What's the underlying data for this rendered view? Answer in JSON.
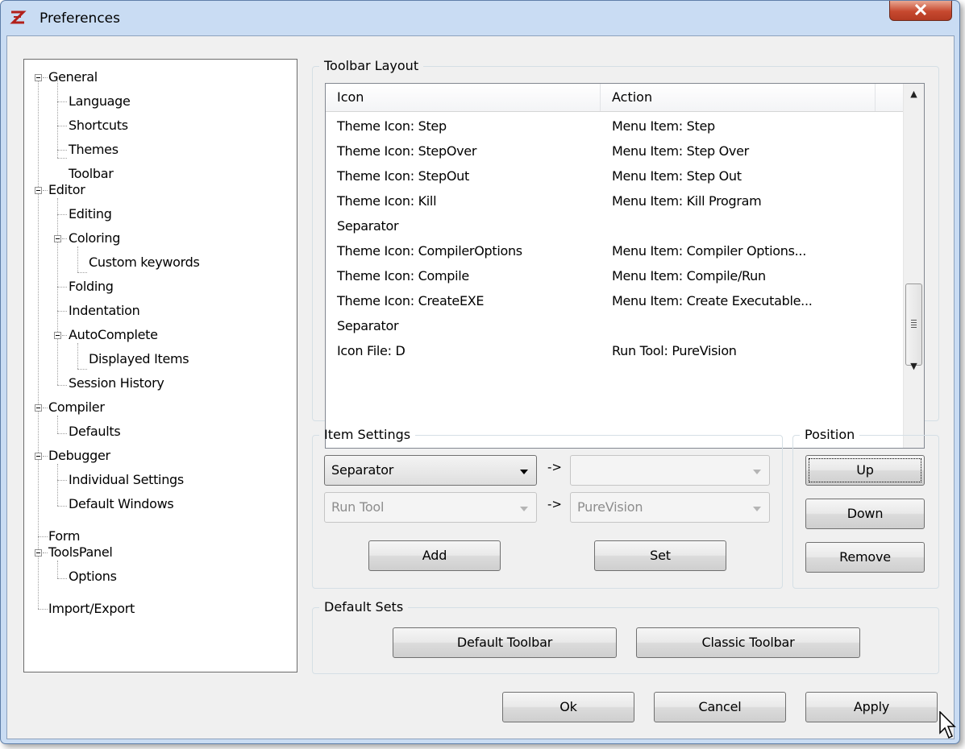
{
  "window": {
    "title": "Preferences"
  },
  "tree": {
    "items": [
      {
        "label": "General"
      },
      {
        "label": "Language"
      },
      {
        "label": "Shortcuts"
      },
      {
        "label": "Themes"
      },
      {
        "label": "Toolbar"
      },
      {
        "label": "Editor"
      },
      {
        "label": "Editing"
      },
      {
        "label": "Coloring"
      },
      {
        "label": "Custom keywords"
      },
      {
        "label": "Folding"
      },
      {
        "label": "Indentation"
      },
      {
        "label": "AutoComplete"
      },
      {
        "label": "Displayed Items"
      },
      {
        "label": "Session History"
      },
      {
        "label": "Compiler"
      },
      {
        "label": "Defaults"
      },
      {
        "label": "Debugger"
      },
      {
        "label": "Individual Settings"
      },
      {
        "label": "Default Windows"
      },
      {
        "label": "Form"
      },
      {
        "label": "ToolsPanel"
      },
      {
        "label": "Options"
      },
      {
        "label": "Import/Export"
      }
    ]
  },
  "toolbar_layout": {
    "legend": "Toolbar Layout",
    "columns": [
      "Icon",
      "Action"
    ],
    "rows": [
      {
        "icon": "Theme Icon: Step",
        "action": "Menu Item: Step"
      },
      {
        "icon": "Theme Icon: StepOver",
        "action": "Menu Item: Step Over"
      },
      {
        "icon": "Theme Icon: StepOut",
        "action": "Menu Item: Step Out"
      },
      {
        "icon": "Theme Icon: Kill",
        "action": "Menu Item: Kill Program"
      },
      {
        "icon": "Separator",
        "action": ""
      },
      {
        "icon": "Theme Icon: CompilerOptions",
        "action": "Menu Item: Compiler Options..."
      },
      {
        "icon": "Theme Icon: Compile",
        "action": "Menu Item: Compile/Run"
      },
      {
        "icon": "Theme Icon: CreateEXE",
        "action": "Menu Item: Create Executable..."
      },
      {
        "icon": "Separator",
        "action": ""
      },
      {
        "icon": "Icon File: D",
        "action": "Run Tool: PureVision"
      }
    ]
  },
  "item_settings": {
    "legend": "Item Settings",
    "type_combo": "Separator",
    "value_combo": "",
    "source_combo": "Run Tool",
    "target_combo": "PureVision",
    "arrow": "->",
    "add_label": "Add",
    "set_label": "Set"
  },
  "position": {
    "legend": "Position",
    "up_label": "Up",
    "down_label": "Down",
    "remove_label": "Remove"
  },
  "default_sets": {
    "legend": "Default Sets",
    "default_label": "Default Toolbar",
    "classic_label": "Classic Toolbar"
  },
  "dialog_buttons": {
    "ok": "Ok",
    "cancel": "Cancel",
    "apply": "Apply"
  },
  "colors": {
    "titlebar": "#c9dcf3",
    "close_button": "#c7492f",
    "client": "#f0f0f0"
  }
}
